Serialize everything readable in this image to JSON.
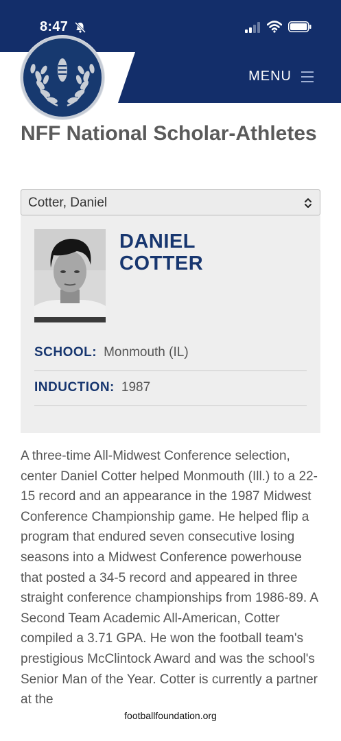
{
  "status_bar": {
    "time": "8:47",
    "icons": [
      "bell-slash-icon",
      "signal-icon",
      "wifi-icon",
      "battery-icon"
    ]
  },
  "header": {
    "menu_label": "MENU",
    "colors": {
      "nav_bg": "#132e6a",
      "accent": "#17366f"
    }
  },
  "page": {
    "title": "NFF National Scholar-Athletes"
  },
  "selector": {
    "selected": "Cotter, Daniel"
  },
  "profile": {
    "first_name": "DANIEL",
    "last_name": "COTTER",
    "school_label": "SCHOOL:",
    "school_value": "Monmouth (IL)",
    "induction_label": "INDUCTION:",
    "induction_value": "1987"
  },
  "bio": {
    "text": "A three-time All-Midwest Conference selection, center Daniel Cotter helped Monmouth (Ill.) to a 22-15 record and an appearance in the 1987 Midwest Conference Championship game. He helped flip a program that endured seven consecutive losing seasons into a Midwest Conference powerhouse that posted a 34-5 record and appeared in three straight conference championships from 1986-89. A Second Team Academic All-American, Cotter compiled a 3.71 GPA. He won the football team's prestigious McClintock Award and was the school's Senior Man of the Year. Cotter is currently a partner at the"
  },
  "browser": {
    "url": "footballfoundation.org"
  }
}
